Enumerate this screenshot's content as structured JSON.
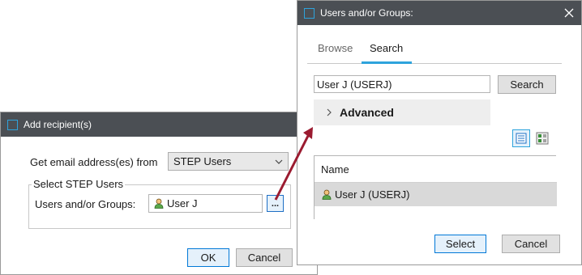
{
  "add_recipient": {
    "title": "Add recipient(s)",
    "source_label": "Get email address(es) from",
    "source_value": "STEP Users",
    "group_label": "Select STEP Users",
    "users_label": "Users and/or Groups:",
    "users_value": "User J",
    "browse_button": "...",
    "ok_label": "OK",
    "cancel_label": "Cancel"
  },
  "users_groups": {
    "title": "Users and/or Groups:",
    "tabs": [
      {
        "label": "Browse",
        "active": false
      },
      {
        "label": "Search",
        "active": true
      }
    ],
    "search_value": "User J (USERJ)",
    "search_button": "Search",
    "advanced_label": "Advanced",
    "table_header": "Name",
    "rows": [
      "User J (USERJ)"
    ],
    "select_label": "Select",
    "cancel_label": "Cancel"
  },
  "colors": {
    "titlebar": "#4b4f54",
    "accent": "#2ea3dc",
    "arrow": "#9b1b30",
    "selected_row": "#d9d9d9"
  }
}
